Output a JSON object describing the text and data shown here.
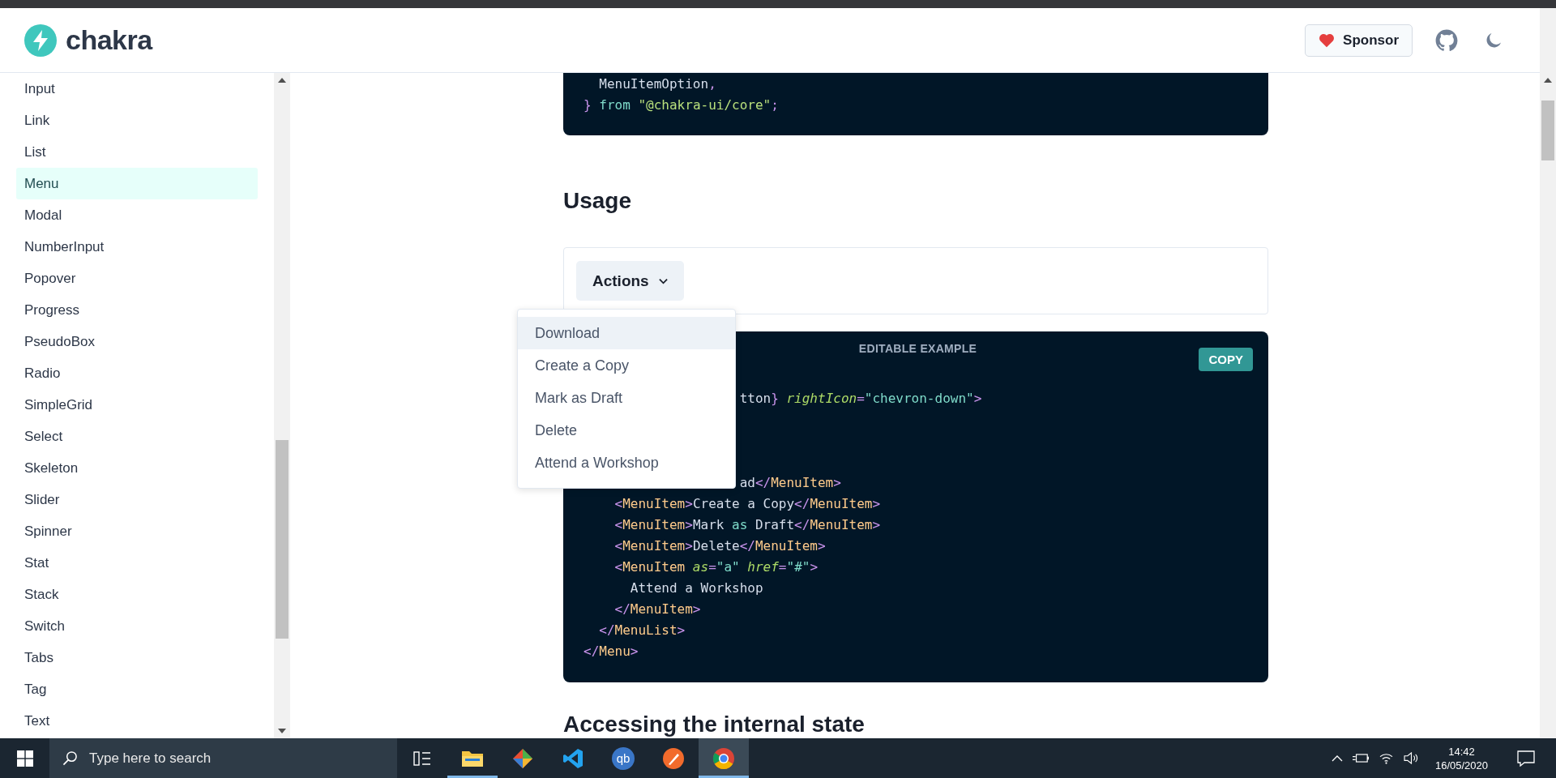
{
  "header": {
    "logo": "chakra",
    "sponsor_button": "Sponsor"
  },
  "sidebar": {
    "items": [
      {
        "label": "Input",
        "selected": false
      },
      {
        "label": "Link",
        "selected": false
      },
      {
        "label": "List",
        "selected": false
      },
      {
        "label": "Menu",
        "selected": true
      },
      {
        "label": "Modal",
        "selected": false
      },
      {
        "label": "NumberInput",
        "selected": false
      },
      {
        "label": "Popover",
        "selected": false
      },
      {
        "label": "Progress",
        "selected": false
      },
      {
        "label": "PseudoBox",
        "selected": false
      },
      {
        "label": "Radio",
        "selected": false
      },
      {
        "label": "SimpleGrid",
        "selected": false
      },
      {
        "label": "Select",
        "selected": false
      },
      {
        "label": "Skeleton",
        "selected": false
      },
      {
        "label": "Slider",
        "selected": false
      },
      {
        "label": "Spinner",
        "selected": false
      },
      {
        "label": "Stat",
        "selected": false
      },
      {
        "label": "Stack",
        "selected": false
      },
      {
        "label": "Switch",
        "selected": false
      },
      {
        "label": "Tabs",
        "selected": false
      },
      {
        "label": "Tag",
        "selected": false
      },
      {
        "label": "Text",
        "selected": false
      }
    ]
  },
  "content": {
    "import_code": [
      {
        "tokens": [
          {
            "kind": "plain",
            "text": "  MenuItemOption"
          },
          {
            "kind": "punct",
            "text": ","
          }
        ]
      },
      {
        "tokens": [
          {
            "kind": "punct",
            "text": "}"
          },
          {
            "kind": "keyword",
            "text": " from"
          },
          {
            "kind": "path",
            "text": " \"@chakra-ui/core\""
          },
          {
            "kind": "punct",
            "text": ";"
          }
        ]
      }
    ],
    "usage_heading": "Usage",
    "demo": {
      "menu_button": "Actions",
      "menu_items": [
        {
          "label": "Download",
          "selected": true
        },
        {
          "label": "Create a Copy",
          "selected": false
        },
        {
          "label": "Mark as Draft",
          "selected": false
        },
        {
          "label": "Delete",
          "selected": false
        },
        {
          "label": "Attend a Workshop",
          "selected": false
        }
      ]
    },
    "example": {
      "label": "EDITABLE EXAMPLE",
      "copy_button": "COPY",
      "lines": [
        {
          "covered": true
        },
        {
          "tokens": [
            {
              "kind": "plain",
              "text": "                    tton"
            },
            {
              "kind": "punct",
              "text": "}"
            },
            {
              "kind": "attr",
              "text": " rightIcon"
            },
            {
              "kind": "punct",
              "text": "="
            },
            {
              "kind": "string",
              "text": "\"chevron-down\""
            },
            {
              "kind": "punct",
              "text": ">"
            }
          ]
        },
        {
          "covered": true
        },
        {
          "covered": true
        },
        {
          "covered": true
        },
        {
          "tokens": [
            {
              "kind": "plain",
              "text": "                    ad"
            },
            {
              "kind": "punct",
              "text": "</"
            },
            {
              "kind": "tag",
              "text": "MenuItem"
            },
            {
              "kind": "punct",
              "text": ">"
            }
          ]
        },
        {
          "tokens": [
            {
              "kind": "punct",
              "text": "    <"
            },
            {
              "kind": "tag",
              "text": "MenuItem"
            },
            {
              "kind": "punct",
              "text": ">"
            },
            {
              "kind": "plain",
              "text": "Create a Copy"
            },
            {
              "kind": "punct",
              "text": "</"
            },
            {
              "kind": "tag",
              "text": "MenuItem"
            },
            {
              "kind": "punct",
              "text": ">"
            }
          ]
        },
        {
          "tokens": [
            {
              "kind": "punct",
              "text": "    <"
            },
            {
              "kind": "tag",
              "text": "MenuItem"
            },
            {
              "kind": "punct",
              "text": ">"
            },
            {
              "kind": "plain",
              "text": "Mark "
            },
            {
              "kind": "keyword",
              "text": "as"
            },
            {
              "kind": "plain",
              "text": " Draft"
            },
            {
              "kind": "punct",
              "text": "</"
            },
            {
              "kind": "tag",
              "text": "MenuItem"
            },
            {
              "kind": "punct",
              "text": ">"
            }
          ]
        },
        {
          "tokens": [
            {
              "kind": "punct",
              "text": "    <"
            },
            {
              "kind": "tag",
              "text": "MenuItem"
            },
            {
              "kind": "punct",
              "text": ">"
            },
            {
              "kind": "plain",
              "text": "Delete"
            },
            {
              "kind": "punct",
              "text": "</"
            },
            {
              "kind": "tag",
              "text": "MenuItem"
            },
            {
              "kind": "punct",
              "text": ">"
            }
          ]
        },
        {
          "tokens": [
            {
              "kind": "punct",
              "text": "    <"
            },
            {
              "kind": "tag",
              "text": "MenuItem"
            },
            {
              "kind": "attr",
              "text": " as"
            },
            {
              "kind": "punct",
              "text": "="
            },
            {
              "kind": "string",
              "text": "\"a\""
            },
            {
              "kind": "attr",
              "text": " href"
            },
            {
              "kind": "punct",
              "text": "="
            },
            {
              "kind": "string",
              "text": "\"#\""
            },
            {
              "kind": "punct",
              "text": ">"
            }
          ]
        },
        {
          "tokens": [
            {
              "kind": "plain",
              "text": "      Attend a Workshop"
            }
          ]
        },
        {
          "tokens": [
            {
              "kind": "punct",
              "text": "    </"
            },
            {
              "kind": "tag",
              "text": "MenuItem"
            },
            {
              "kind": "punct",
              "text": ">"
            }
          ]
        },
        {
          "tokens": [
            {
              "kind": "punct",
              "text": "  </"
            },
            {
              "kind": "tag",
              "text": "MenuList"
            },
            {
              "kind": "punct",
              "text": ">"
            }
          ]
        },
        {
          "tokens": [
            {
              "kind": "punct",
              "text": "</"
            },
            {
              "kind": "tag",
              "text": "Menu"
            },
            {
              "kind": "punct",
              "text": ">"
            }
          ]
        }
      ]
    },
    "next_heading": "Accessing the internal state"
  },
  "taskbar": {
    "search_placeholder": "Type here to search",
    "app_letters": "qb",
    "time": "14:42",
    "date": "16/05/2020"
  }
}
